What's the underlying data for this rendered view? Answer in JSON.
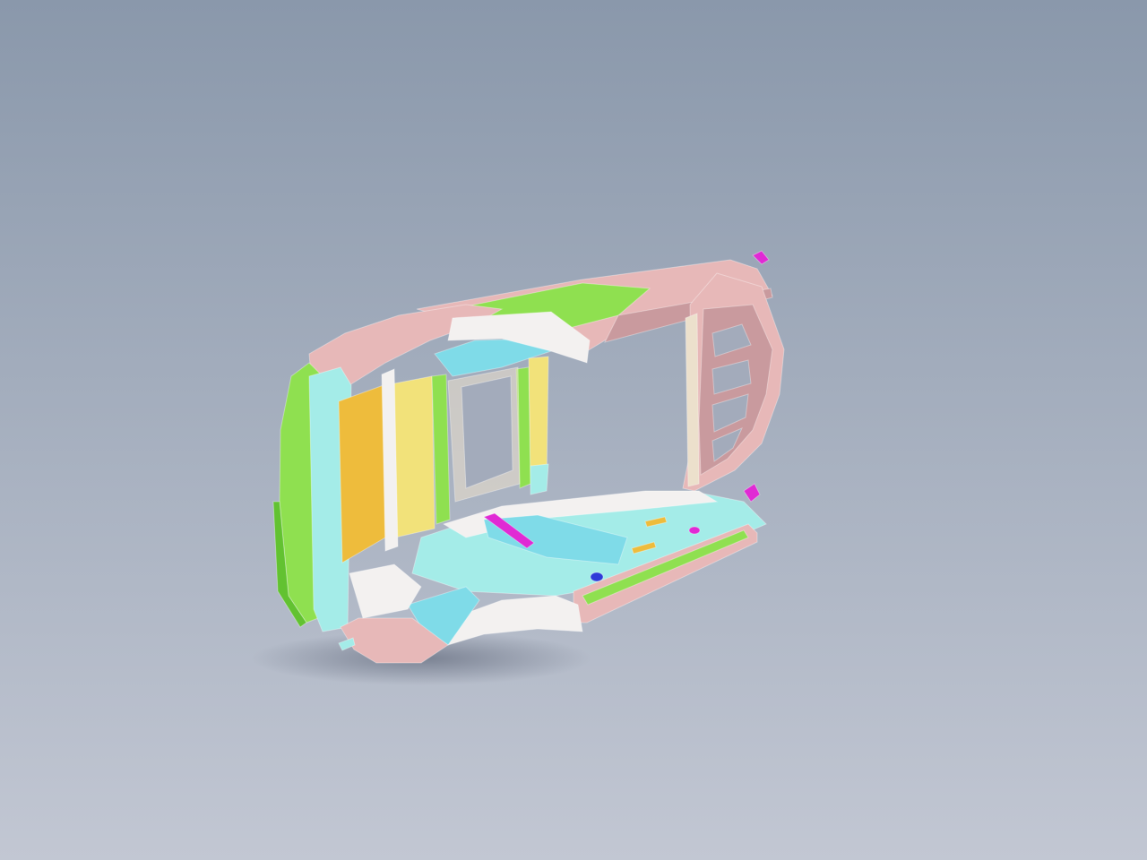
{
  "viewport": {
    "background_top": "#8a98ab",
    "background_bottom": "#c2c7d3"
  },
  "model": {
    "colors": {
      "pink": "#e7b8b8",
      "pink_dark": "#c99a9e",
      "green": "#8fe050",
      "green_dark": "#62c231",
      "yellow": "#f2e27a",
      "orange": "#eebc3c",
      "cyan": "#a4ece8",
      "cyan_mid": "#7fdbe8",
      "white": "#f3f1f0",
      "cream": "#ece0cc",
      "magenta": "#e02ad4",
      "blue": "#2e3ad8",
      "shadow": "#5d6678"
    }
  }
}
